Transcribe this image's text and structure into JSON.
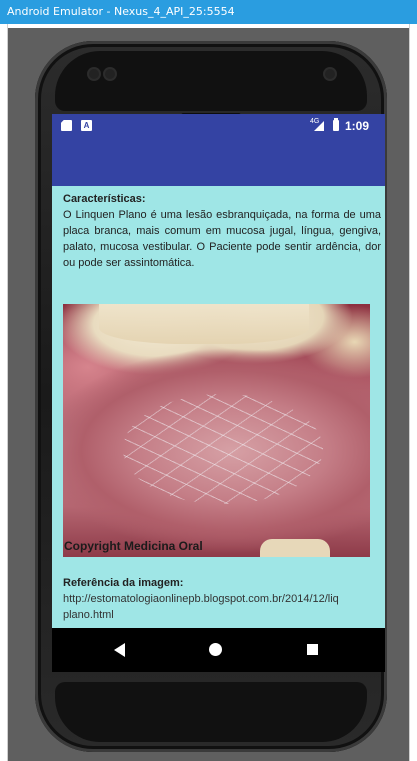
{
  "window": {
    "title": "Android Emulator - Nexus_4_API_25:5554"
  },
  "statusbar": {
    "icons": [
      "sd-card-icon",
      "a-icon",
      "signal-icon",
      "battery-icon"
    ],
    "a_label": "A",
    "signal_label": "4G",
    "time": "1:09"
  },
  "content": {
    "section_title": "Características:",
    "description": "O Linquen Plano é uma lesão esbranquiçada, na forma de uma placa branca, mais comum em mucosa jugal, língua, gengiva, palato, mucosa vestibular. O Paciente pode sentir ardência, dor ou pode ser assintomática.",
    "image_caption": "Copyright Medicina Oral",
    "reference_title": "Referência da imagem:",
    "reference_url_line1": "http://estomatologiaonlinepb.blogspot.com.br/2014/12/liq",
    "reference_url_line2": "plano.html"
  },
  "navbar": {
    "icons": [
      "back-icon",
      "home-icon",
      "recents-icon"
    ]
  },
  "colors": {
    "appbar": "#3443a3",
    "background": "#9fe6e6",
    "titlebar": "#2a9de0"
  }
}
